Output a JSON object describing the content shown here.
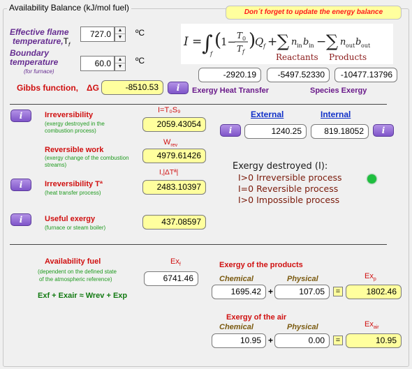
{
  "group_title": "Availability Balance (kJ/mol fuel)",
  "reminder": "Don´t forget to update the energy balance",
  "flame": {
    "label1": "Effective flame",
    "label2": "temperature,",
    "label2_sym": "T",
    "label2_sub": "f",
    "value": "727.0",
    "unit": "ºC"
  },
  "boundary": {
    "label1": "Boundary",
    "label2": "temperature",
    "note": "(for furnace)",
    "value": "60.0",
    "unit": "ºC"
  },
  "gibbs": {
    "label": "Gibbs function,",
    "symbol": "ΔG",
    "value": "-8510.53"
  },
  "formula": {
    "reactants": "Reactants",
    "products": "Products"
  },
  "balance_values": [
    "-2920.19",
    "-5497.52330",
    "-10477.13796"
  ],
  "exergy_heat_transfer": "Exergy Heat Transfer",
  "species_exergy": "Species Exergy",
  "irreversibility": {
    "label": "Irreversibility",
    "desc": "(exergy destroyed in the combustion process)",
    "symbol": "I=T₀S₉",
    "value": "2059.43054"
  },
  "external": {
    "label": "External",
    "value": "1240.25"
  },
  "internal": {
    "label": "Internal",
    "value": "819.18052"
  },
  "reversible": {
    "label": "Reversible work",
    "desc": "(exergy change of the combustion streams)",
    "symbol": "W",
    "symbol_sub": "rev",
    "value": "4979.61426"
  },
  "irrev_t": {
    "label": "Irreversibility Tª",
    "desc": "(heat transfer process)",
    "symbol": "I,|ΔTª|",
    "value": "2483.10397"
  },
  "exergy_destroyed": {
    "title": "Exergy destroyed (I):",
    "lines": [
      "I>0 Irreversible process",
      "I=0 Reversible process",
      "I>0 Impossible process"
    ]
  },
  "useful": {
    "label": "Useful exergy",
    "desc": "(furnace or steam boiler)",
    "value": "437.08597"
  },
  "avail_fuel": {
    "label": "Availability fuel",
    "desc1": "(dependent on the defined state",
    "desc2": "of the atmospheric reference)",
    "symbol": "Ex",
    "symbol_sub": "f",
    "value": "6741.46",
    "equation": "Exf + Exair ≈ Wrev + Exp"
  },
  "products": {
    "title": "Exergy of the products",
    "chemical": "Chemical",
    "physical": "Physical",
    "chem_value": "1695.42",
    "phys_value": "107.05",
    "symbol": "Ex",
    "symbol_sub": "p",
    "total": "1802.46"
  },
  "air": {
    "title": "Exergy of the air",
    "chemical": "Chemical",
    "physical": "Physical",
    "chem_value": "10.95",
    "phys_value": "0.00",
    "symbol": "Ex",
    "symbol_sub": "air",
    "total": "10.95"
  },
  "info_icon_glyph": "i",
  "status_color": "#1fbf3f"
}
